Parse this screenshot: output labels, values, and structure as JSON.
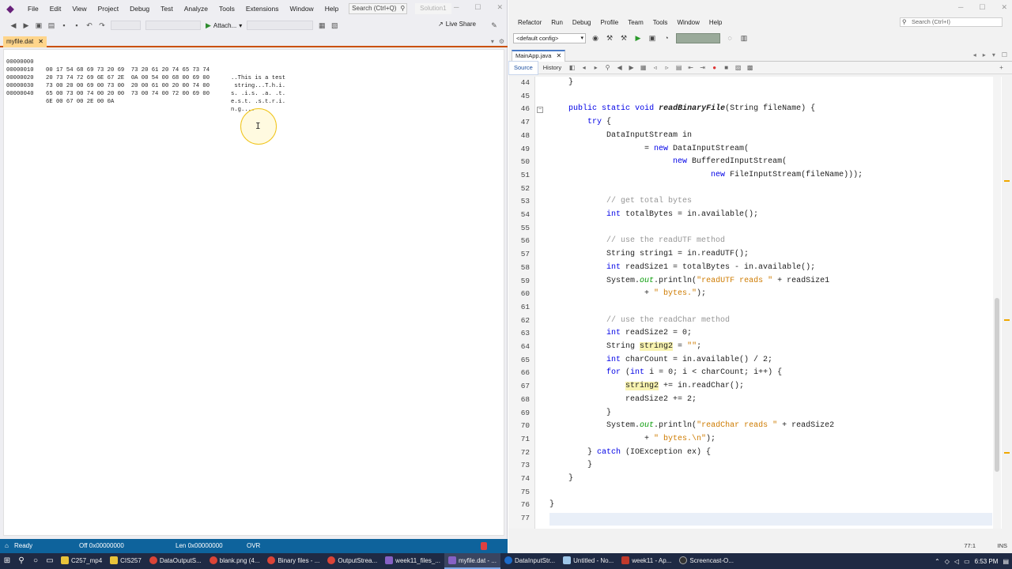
{
  "vs": {
    "menu": [
      "File",
      "Edit",
      "View",
      "Project",
      "Debug",
      "Test",
      "Analyze",
      "Tools",
      "Extensions",
      "Window",
      "Help"
    ],
    "search_placeholder": "Search (Ctrl+Q)",
    "solution_label": "Solution1",
    "attach_label": "Attach...",
    "live_share_label": "Live Share",
    "doc_tab_label": "myfile.dat",
    "hex_rows": [
      {
        "offset": "00000000",
        "bytes": "00 17 54 68 69 73 20 69  73 20 61 20 74 65 73 74",
        "ascii": "..This is a test"
      },
      {
        "offset": "00000010",
        "bytes": "20 73 74 72 69 6E 67 2E  0A 00 54 00 68 00 69 00",
        "ascii": " string...T.h.i."
      },
      {
        "offset": "00000020",
        "bytes": "73 00 20 00 69 00 73 00  20 00 61 00 20 00 74 00",
        "ascii": "s. .i.s. .a. .t."
      },
      {
        "offset": "00000030",
        "bytes": "65 00 73 00 74 00 20 00  73 00 74 00 72 00 69 00",
        "ascii": "e.s.t. .s.t.r.i."
      },
      {
        "offset": "00000040",
        "bytes": "6E 00 67 00 2E 00 0A",
        "ascii": "n.g...."
      }
    ],
    "status": {
      "ready": "Ready",
      "offset": "Off 0x00000000",
      "length": "Len 0x00000000",
      "mode": "OVR"
    }
  },
  "nb": {
    "menu": [
      "Refactor",
      "Run",
      "Debug",
      "Profile",
      "Team",
      "Tools",
      "Window",
      "Help"
    ],
    "search_placeholder": "Search (Ctrl+I)",
    "config_label": "<default config>",
    "file_tab_label": "MainApp.java",
    "source_tab": "Source",
    "history_tab": "History",
    "line_numbers": [
      "44",
      "45",
      "46",
      "47",
      "48",
      "49",
      "50",
      "51",
      "52",
      "53",
      "54",
      "55",
      "56",
      "57",
      "58",
      "59",
      "60",
      "61",
      "62",
      "63",
      "64",
      "65",
      "66",
      "67",
      "68",
      "69",
      "70",
      "71",
      "72",
      "73",
      "74",
      "75",
      "76",
      "77"
    ],
    "status_position": "77:1",
    "status_mode": "INS"
  },
  "taskbar": {
    "items": [
      "C257_mp4",
      "CIS257",
      "DataOutputS...",
      "blank.png (4...",
      "Binary files - ...",
      "OutputStrea...",
      "week11_files_...",
      "myfile.dat - ...",
      "DataInputStr...",
      "Untitled - No...",
      "week11 - Ap...",
      "Screencast-O..."
    ],
    "time": "6:53 PM"
  }
}
